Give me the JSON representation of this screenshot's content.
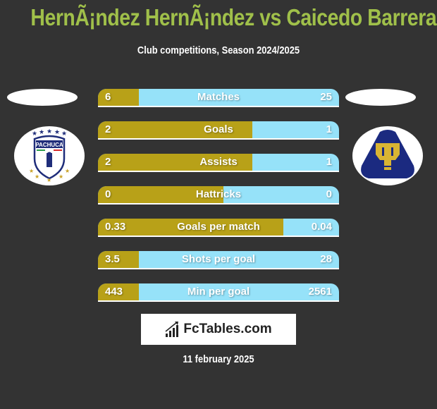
{
  "header": {
    "title": "HernÃ¡ndez HernÃ¡ndez vs Caicedo Barrera",
    "subtitle": "Club competitions, Season 2024/2025"
  },
  "teams": {
    "left": {
      "name": "Pachuca",
      "logo_icon": "pachuca-crest-icon",
      "crest_text": "PACHUCA"
    },
    "right": {
      "name": "Pumas UNAM",
      "logo_icon": "pumas-crest-icon"
    }
  },
  "colors": {
    "left_bar": "#b8a118",
    "right_bar": "#96e2f9",
    "title": "#a0c04a",
    "background": "#333333"
  },
  "stats": [
    {
      "label": "Matches",
      "left": "6",
      "right": "25",
      "left_share": 0.17
    },
    {
      "label": "Goals",
      "left": "2",
      "right": "1",
      "left_share": 0.64
    },
    {
      "label": "Assists",
      "left": "2",
      "right": "1",
      "left_share": 0.64
    },
    {
      "label": "Hattricks",
      "left": "0",
      "right": "0",
      "left_share": 0.52
    },
    {
      "label": "Goals per match",
      "left": "0.33",
      "right": "0.04",
      "left_share": 0.77
    },
    {
      "label": "Shots per goal",
      "left": "3.5",
      "right": "28",
      "left_share": 0.17
    },
    {
      "label": "Min per goal",
      "left": "443",
      "right": "2561",
      "left_share": 0.17
    }
  ],
  "brand": {
    "text": "FcTables.com",
    "icon": "bar-chart-icon"
  },
  "footer": {
    "date": "11 february 2025"
  }
}
